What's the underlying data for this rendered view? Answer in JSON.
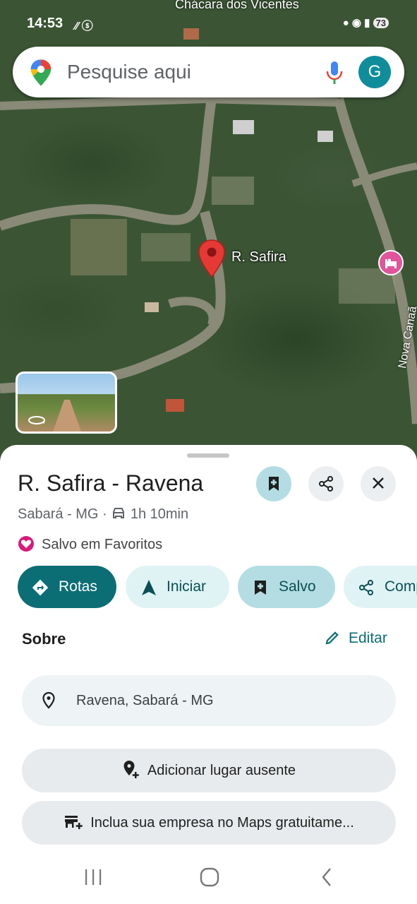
{
  "status_bar": {
    "time": "14:53",
    "battery": "73"
  },
  "map": {
    "top_label": "Chácara dos Vicentes",
    "marker_label": "R. Safira",
    "road_label": "Nova Canaã",
    "search_placeholder": "Pesquise aqui",
    "avatar_letter": "G"
  },
  "place": {
    "title": "R. Safira - Ravena",
    "subtitle": "Sabará - MG · ",
    "drive_time": "1h 10min",
    "saved_text": "Salvo em Favoritos"
  },
  "actions": {
    "routes": "Rotas",
    "start": "Iniciar",
    "saved": "Salvo",
    "share": "Compartilhar"
  },
  "about": {
    "heading": "Sobre",
    "edit": "Editar",
    "address": "Ravena, Sabará - MG",
    "add_missing": "Adicionar lugar ausente",
    "add_business": "Inclua sua empresa no Maps gratuitame..."
  },
  "colors": {
    "accent": "#0b6e75",
    "chip_light": "#dff3f5",
    "chip_saved": "#b3dde3",
    "map_green": "#3b5534"
  }
}
